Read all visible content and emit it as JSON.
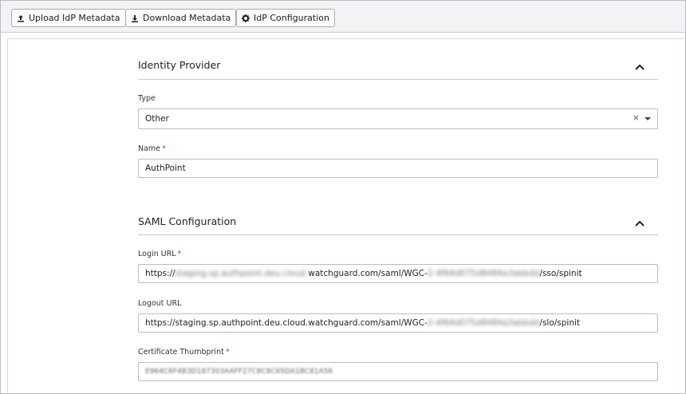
{
  "toolbar": {
    "upload_label": "Upload IdP Metadata",
    "download_label": "Download Metadata",
    "config_label": "IdP Configuration"
  },
  "identity_provider": {
    "title": "Identity Provider",
    "type_label": "Type",
    "type_value": "Other",
    "name_label": "Name",
    "name_value": "AuthPoint"
  },
  "saml": {
    "title": "SAML Configuration",
    "login_label": "Login URL",
    "login_pre": "https://",
    "login_blur1": "staging.sp.authpoint.deu.cloud.",
    "login_mid": "watchguard.com/saml/WGC-",
    "login_blur2": "2-4f64d075d8484a3abbdd",
    "login_post": "/sso/spinit",
    "logout_label": "Logout URL",
    "logout_pre": "https://staging.sp.authpoint.deu.cloud.watchguard.com/saml/WGC-",
    "logout_blur": "2-4f64d075d8484a3abbdd",
    "logout_post": "/slo/spinit",
    "cert_label": "Certificate Thumbprint",
    "cert_value": "E964C6F4B3D187303AAFF27C8C8C65DA1BC81A56"
  }
}
